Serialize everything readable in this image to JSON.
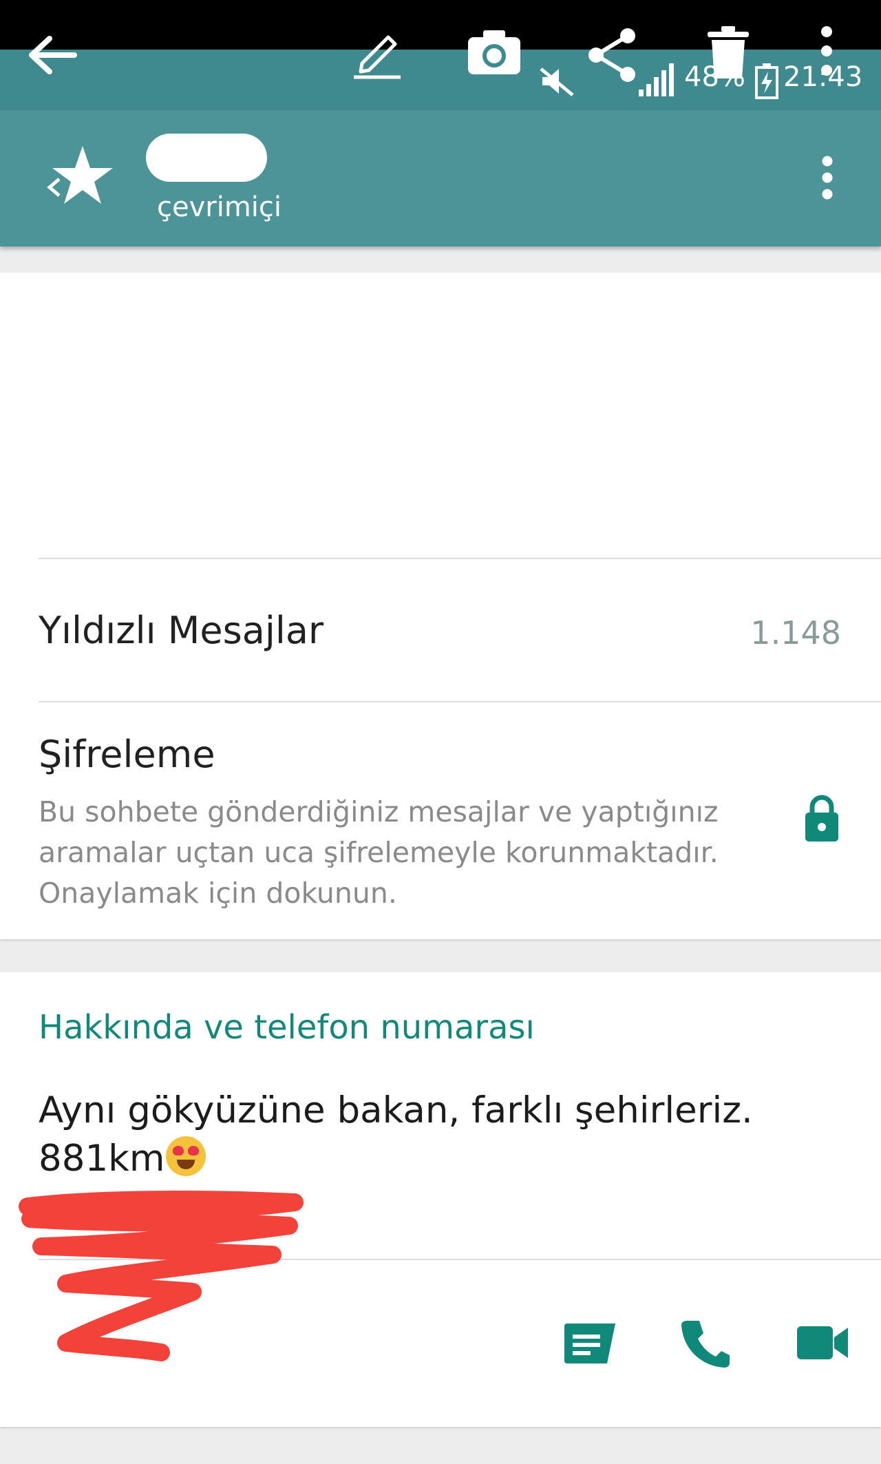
{
  "status_bar": {
    "battery_percent": "48%",
    "time": "21:43"
  },
  "edit_toolbar": {
    "icons": [
      "back-arrow-icon",
      "pencil-icon",
      "camera-icon",
      "share-icon",
      "trash-icon",
      "more-vert-icon"
    ]
  },
  "header": {
    "status": "çevrimiçi"
  },
  "starred": {
    "label": "Yıldızlı Mesajlar",
    "count": "1.148"
  },
  "encryption": {
    "title": "Şifreleme",
    "description": "Bu sohbete gönderdiğiniz mesajlar ve yaptığınız aramalar uçtan uca şifrelemeyle korunmaktadır. Onaylamak için dokunun."
  },
  "about": {
    "section_title": "Hakkında ve telefon numarası",
    "line1": "Aynı gökyüzüne bakan, farklı şehirleriz.",
    "line2": "881km"
  },
  "colors": {
    "accent": "#10897a",
    "header": "#4c9498",
    "toolbar": "#3f8a8f",
    "redaction": "#f2423a"
  }
}
